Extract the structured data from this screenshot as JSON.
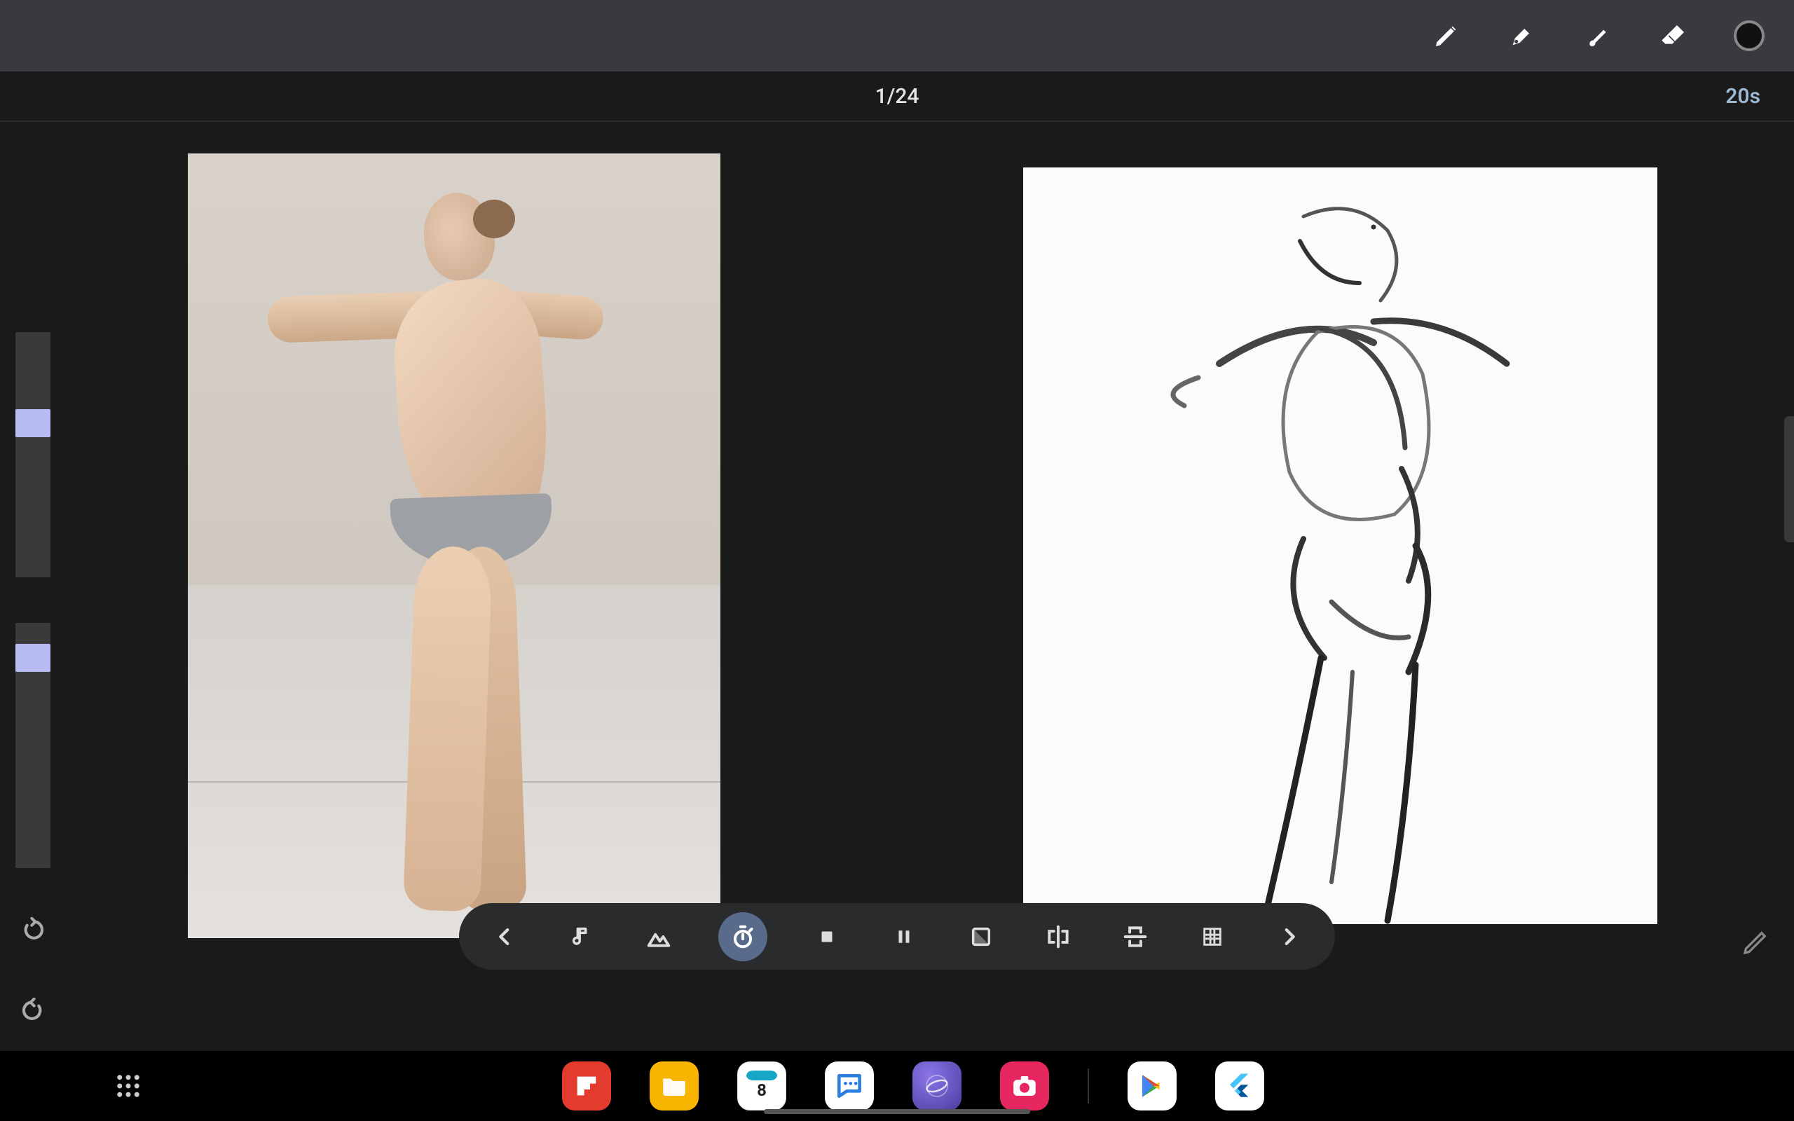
{
  "toolbar": {
    "tools": [
      "draw",
      "pen",
      "brush",
      "eraser",
      "color"
    ],
    "current_color": "#141414"
  },
  "status": {
    "progress_label": "1/24",
    "current_index": 1,
    "total": 24,
    "timer_label": "20s",
    "timer_seconds": 20
  },
  "sidebar": {
    "brush_size_percent": 31,
    "opacity_percent": 8
  },
  "reference": {
    "description": "standing-figure-back-arms-out"
  },
  "playback": {
    "buttons": [
      {
        "name": "prev",
        "icon": "chevron-left"
      },
      {
        "name": "audio",
        "icon": "music-note"
      },
      {
        "name": "filter",
        "icon": "mountains"
      },
      {
        "name": "timer",
        "icon": "stopwatch",
        "active": true
      },
      {
        "name": "stop",
        "icon": "stop"
      },
      {
        "name": "pause",
        "icon": "pause"
      },
      {
        "name": "contrast",
        "icon": "contrast"
      },
      {
        "name": "flip-h",
        "icon": "flip-horizontal"
      },
      {
        "name": "flip-v",
        "icon": "flip-vertical"
      },
      {
        "name": "grid",
        "icon": "grid"
      },
      {
        "name": "next",
        "icon": "chevron-right"
      }
    ]
  },
  "taskbar": {
    "apps": [
      {
        "name": "flipboard",
        "color": "#e33b2e",
        "icon": "F"
      },
      {
        "name": "files",
        "color": "#f8b500"
      },
      {
        "name": "calendar",
        "color": "#16a6c7",
        "day": "8"
      },
      {
        "name": "messages",
        "color": "#ffffff"
      },
      {
        "name": "browser",
        "color": "#6b57c9"
      },
      {
        "name": "camera",
        "color": "#e6275f"
      },
      {
        "name": "play-store",
        "color": "#ffffff"
      },
      {
        "name": "flutter",
        "color": "#ffffff"
      }
    ]
  }
}
